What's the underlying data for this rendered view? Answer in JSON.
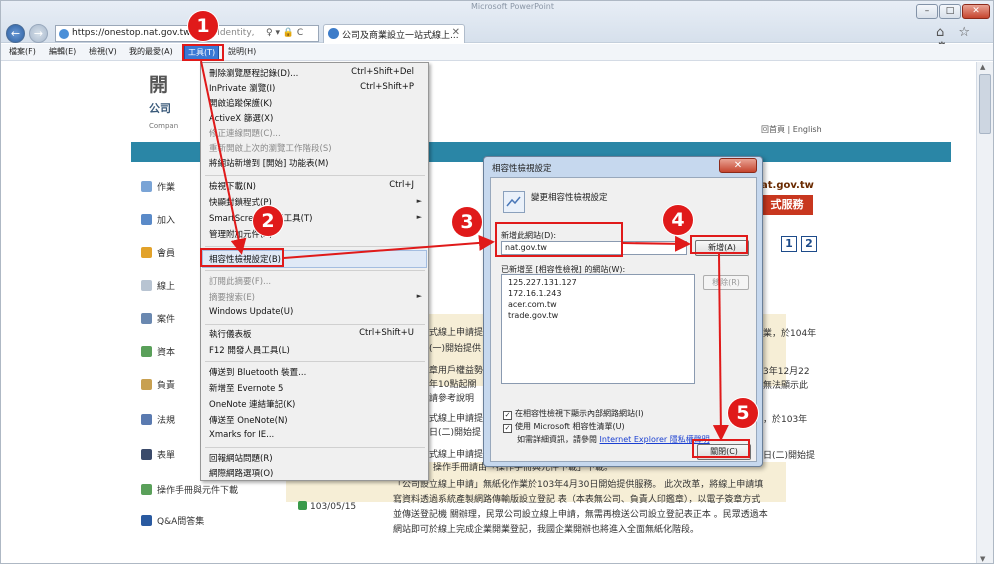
{
  "browser": {
    "title": "Microsoft PowerPoint",
    "url": "https://onestop.nat.gov.tw",
    "url_rest": "/ntity/Identity,",
    "tab_label": "公司及商業設立一站式線上...",
    "window_buttons": {
      "min": "–",
      "max": "□",
      "close": "✕"
    },
    "addr_icons": "♀ ▾ 🔒 C",
    "home_icons": "⌂ ☆ ⚙"
  },
  "menubar": {
    "file": "檔案(F)",
    "edit": "編輯(E)",
    "view": "檢視(V)",
    "favorites": "我的最愛(A)",
    "tools": "工具(T)",
    "help": "說明(H)"
  },
  "site": {
    "title": "開",
    "subtitle": "公司",
    "en": "Compan",
    "home_link": "回首頁 | English",
    "banner_text": "at.gov.tw",
    "banner_box": "式服務",
    "pages": [
      "1",
      "2"
    ]
  },
  "sidebar": {
    "items": [
      {
        "label": "作業"
      },
      {
        "label": "加入"
      },
      {
        "label": "會員"
      },
      {
        "label": "線上"
      },
      {
        "label": "案件"
      },
      {
        "label": "資本"
      },
      {
        "label": "負責"
      },
      {
        "label": "法規"
      },
      {
        "label": "表單"
      },
      {
        "label": "操作手冊與元件下載"
      },
      {
        "label": "Q&A問答集"
      }
    ]
  },
  "content": {
    "lines_left": [
      "式線上申請提",
      "(一)開始提供",
      "章用戶權益勢",
      "年10點起關",
      "請參考說明",
      "式線上申請提",
      "日(二)開始提",
      "式線上申請提",
      "操作手冊請由「操作手冊與元件下載」下載。"
    ],
    "lines_right": [
      "業，於104年",
      "3年12月22",
      "無法顯示此",
      "，於103年",
      "日(二)開始提"
    ],
    "date": "103/05/15",
    "news": [
      "「公司設立線上申請」無紙化作業於103年4月30日開始提供服務。 此次改革，將線上申請填",
      "寫資料透過系統產製網路傳輸版設立登記 表（本表無公司、負責人印鑑章），以電子簽章方式",
      "並傳送登記機 關辦理，民眾公司設立線上申請，無需再檢送公司設立登記表正本 。民眾透過本",
      "網站即可於線上完成企業開業登記，我國企業開辦也將進入全面無紙化階段。"
    ]
  },
  "tools_menu": {
    "items": [
      {
        "label": "刪除瀏覽歷程記錄(D)...",
        "shortcut": "Ctrl+Shift+Del"
      },
      {
        "label": "InPrivate 瀏覽(I)",
        "shortcut": "Ctrl+Shift+P"
      },
      {
        "label": "開啟追蹤保護(K)",
        "shortcut": ""
      },
      {
        "label": "ActiveX 篩選(X)",
        "shortcut": ""
      },
      {
        "label": "修正連線問題(C)...",
        "shortcut": ""
      },
      {
        "label": "重新開啟上次的瀏覽工作階段(S)",
        "shortcut": ""
      },
      {
        "label": "將網站新增到 [開始] 功能表(M)",
        "shortcut": ""
      },
      {
        "label": "檢視下載(N)",
        "shortcut": "Ctrl+J"
      },
      {
        "label": "快顯封鎖程式(P)",
        "shortcut": ""
      },
      {
        "label": "SmartScreen 篩選工具(T)",
        "shortcut": ""
      },
      {
        "label": "管理附加元件(A)",
        "shortcut": ""
      },
      {
        "label": "相容性檢視設定(B)",
        "shortcut": ""
      },
      {
        "label": "訂閱此摘要(F)...",
        "shortcut": ""
      },
      {
        "label": "摘要搜索(E)",
        "shortcut": ""
      },
      {
        "label": "Windows Update(U)",
        "shortcut": ""
      },
      {
        "label": "執行儀表板",
        "shortcut": "Ctrl+Shift+U"
      },
      {
        "label": "F12 開發人員工具(L)",
        "shortcut": ""
      },
      {
        "label": "傳送到 Bluetooth 裝置...",
        "shortcut": ""
      },
      {
        "label": "新增至 Evernote 5",
        "shortcut": ""
      },
      {
        "label": "OneNote 連結筆記(K)",
        "shortcut": ""
      },
      {
        "label": "傳送至 OneNote(N)",
        "shortcut": ""
      },
      {
        "label": "Xmarks for IE...",
        "shortcut": ""
      },
      {
        "label": "回報網站問題(R)",
        "shortcut": ""
      },
      {
        "label": "網際網路選項(O)",
        "shortcut": ""
      }
    ]
  },
  "dialog": {
    "title": "相容性檢視設定",
    "heading": "變更相容性檢視設定",
    "add_label": "新增此網站(D):",
    "add_value": "nat.gov.tw",
    "add_button": "新增(A)",
    "list_label": "已新增至 [相容性檢視] 的網站(W):",
    "sites": [
      "125.227.131.127",
      "172.16.1.243",
      "acer.com.tw",
      "trade.gov.tw"
    ],
    "remove_button": "移除(R)",
    "check_intranet": "在相容性檢視下顯示內部網路網站(I)",
    "check_mslist": "使用 Microsoft 相容性清單(U)",
    "info_prefix": "如需詳細資訊，請參閱 ",
    "info_link": "Internet Explorer 隱私權聲明",
    "close_button": "關閉(C)",
    "close_x": "✕"
  },
  "annotations": {
    "steps": [
      "1",
      "2",
      "3",
      "4",
      "5"
    ],
    "color": "#e01a1a"
  }
}
